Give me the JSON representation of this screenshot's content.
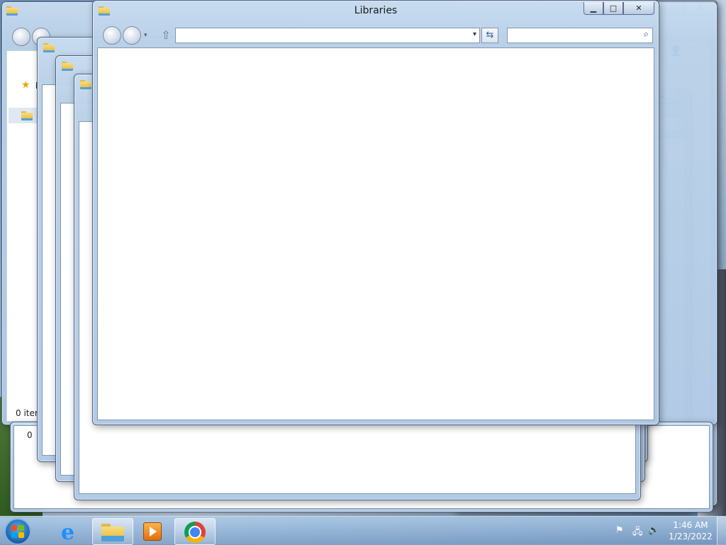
{
  "front_window": {
    "title": "Libraries",
    "minimize_glyph": "▁",
    "maximize_glyph": "□",
    "close_glyph": "✕",
    "address_value": "",
    "address_dropdown_glyph": "▾",
    "refresh_glyph": "⇆",
    "search_placeholder": "",
    "search_icon_glyph": "⌕",
    "up_glyph": "⇧"
  },
  "back_window": {
    "favorites_star_glyph": "★",
    "favorites_partial": "F",
    "libraries_partial": "L",
    "status_text": "0 item"
  },
  "stacked_window": {
    "status_text": "0"
  },
  "right_window": {
    "close_glyph": "✕",
    "restore_glyph": "□",
    "account_glyph": "👤",
    "menu_glyph": "⋮"
  },
  "right_window_2": {
    "close_glyph": "✕",
    "search_icon_glyph": "⌕"
  },
  "taskbar": {
    "tray_flag_glyph": "⚑",
    "tray_network_glyph": "🖧",
    "tray_volume_glyph": "🔈",
    "clock_time": "1:46 AM",
    "clock_date": "1/23/2022"
  },
  "colors": {
    "start_orb": "#1b5fa8",
    "window_frame": "#b9d0e8",
    "client_bg": "#ffffff"
  }
}
